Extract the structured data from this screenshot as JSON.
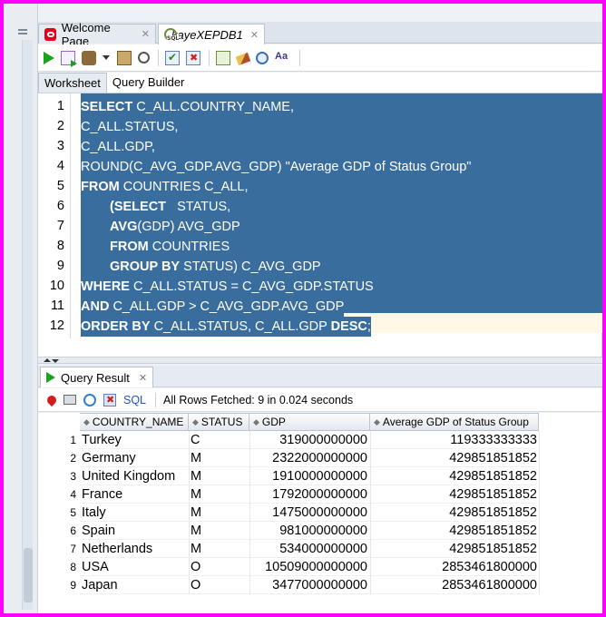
{
  "tabs": [
    {
      "label": "Welcome Page",
      "icon": "oracle-icon",
      "active": false
    },
    {
      "label": "kayeXEPDB1",
      "icon": "sql-connection-icon",
      "active": true
    }
  ],
  "subtabs": {
    "worksheet": "Worksheet",
    "query_builder": "Query Builder"
  },
  "editor": {
    "line_numbers": [
      "1",
      "2",
      "3",
      "4",
      "5",
      "6",
      "7",
      "8",
      "9",
      "10",
      "11",
      "12"
    ],
    "lines": [
      {
        "kw": "SELECT",
        "rest": " C_ALL.COUNTRY_NAME,",
        "indent": ""
      },
      {
        "kw": "",
        "rest": "C_ALL.STATUS,",
        "indent": ""
      },
      {
        "kw": "",
        "rest": "C_ALL.GDP,",
        "indent": ""
      },
      {
        "kw": "",
        "rest": "ROUND(C_AVG_GDP.AVG_GDP) \"Average GDP of Status Group\"",
        "indent": ""
      },
      {
        "kw": "FROM",
        "rest": " COUNTRIES C_ALL,",
        "indent": ""
      },
      {
        "kw": "(SELECT",
        "rest": "   STATUS,",
        "indent": "      "
      },
      {
        "kw": "AVG",
        "rest": "(GDP) AVG_GDP",
        "indent": "      "
      },
      {
        "kw": "FROM",
        "rest": " COUNTRIES",
        "indent": "      "
      },
      {
        "kw": "GROUP BY",
        "rest": " STATUS) C_AVG_GDP",
        "indent": "      "
      },
      {
        "kw": "WHERE",
        "rest": " C_ALL.STATUS = C_AVG_GDP.STATUS",
        "indent": ""
      },
      {
        "kw": "AND",
        "rest": " C_ALL.GDP > C_AVG_GDP.AVG_GDP",
        "indent": ""
      },
      {
        "kw": "ORDER BY",
        "rest": " C_ALL.STATUS, C_ALL.GDP ",
        "kw2": "DESC",
        "tail": ";",
        "indent": ""
      }
    ]
  },
  "results": {
    "tab_label": "Query Result",
    "sql_link": "SQL",
    "fetch_status": "All Rows Fetched: 9 in 0.024 seconds",
    "columns": [
      "COUNTRY_NAME",
      "STATUS",
      "GDP",
      "Average GDP of Status Group"
    ],
    "rows": [
      {
        "n": "1",
        "country": "Turkey",
        "status": "C",
        "gdp": "319000000000",
        "avg": "119333333333"
      },
      {
        "n": "2",
        "country": "Germany",
        "status": "M",
        "gdp": "2322000000000",
        "avg": "429851851852"
      },
      {
        "n": "3",
        "country": "United Kingdom",
        "status": "M",
        "gdp": "1910000000000",
        "avg": "429851851852"
      },
      {
        "n": "4",
        "country": "France",
        "status": "M",
        "gdp": "1792000000000",
        "avg": "429851851852"
      },
      {
        "n": "5",
        "country": "Italy",
        "status": "M",
        "gdp": "1475000000000",
        "avg": "429851851852"
      },
      {
        "n": "6",
        "country": "Spain",
        "status": "M",
        "gdp": "981000000000",
        "avg": "429851851852"
      },
      {
        "n": "7",
        "country": "Netherlands",
        "status": "M",
        "gdp": "534000000000",
        "avg": "429851851852"
      },
      {
        "n": "8",
        "country": "USA",
        "status": "O",
        "gdp": "10509000000000",
        "avg": "2853461800000"
      },
      {
        "n": "9",
        "country": "Japan",
        "status": "O",
        "gdp": "3477000000000",
        "avg": "2853461800000"
      }
    ]
  }
}
